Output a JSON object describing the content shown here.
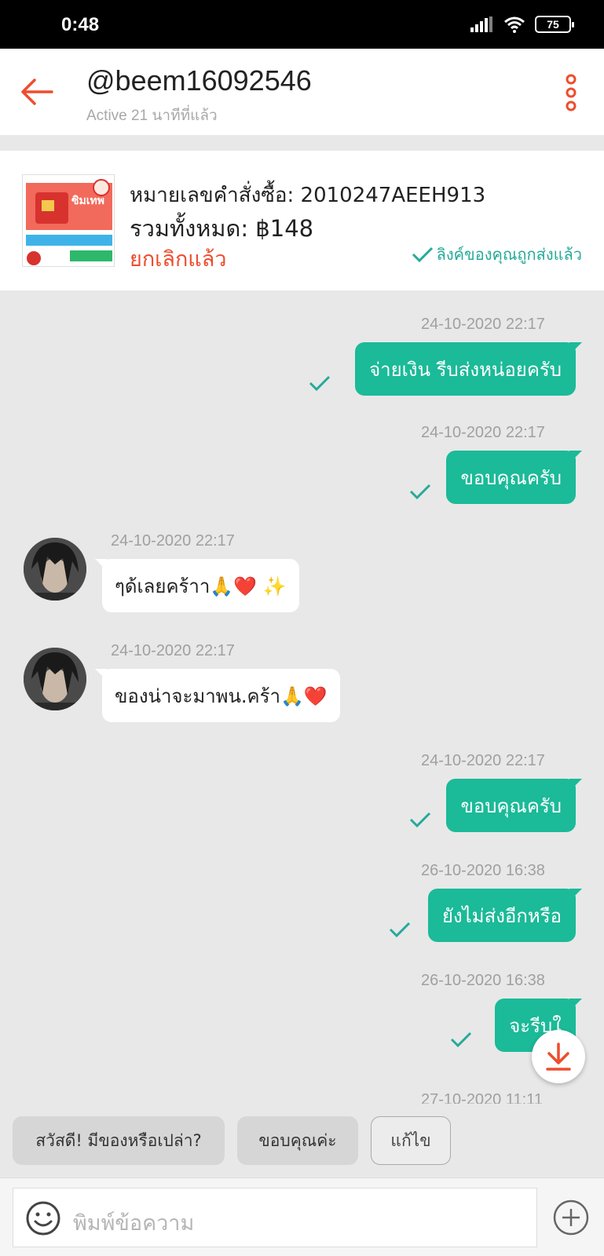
{
  "status_bar": {
    "time": "0:48",
    "battery": "75"
  },
  "header": {
    "title": "@beem16092546",
    "subtitle": "Active 21 นาทีที่แล้ว",
    "accent_color": "#ee4d2d"
  },
  "order": {
    "number_label": "หมายเลขคำสั่งซื้อ: 2010247AEEH913",
    "total_label": "รวมทั้งหมด: ฿148",
    "status": "ยกเลิกแล้ว",
    "link_status": "ลิงค์ของคุณถูกส่งแล้ว",
    "thumb_text": "ซิมเทพ"
  },
  "messages": [
    {
      "direction": "out",
      "time": "24-10-2020 22:17",
      "text": "จ่ายเงิน รีบส่งหน่อยครับ"
    },
    {
      "direction": "out",
      "time": "24-10-2020 22:17",
      "text": "ขอบคุณครับ"
    },
    {
      "direction": "in",
      "time": "24-10-2020 22:17",
      "text": "ๆด้เลยคร้าา🙏❤️ ✨"
    },
    {
      "direction": "in",
      "time": "24-10-2020 22:17",
      "text": "ของน่าจะมาพน.คร้า🙏❤️"
    },
    {
      "direction": "out",
      "time": "24-10-2020 22:17",
      "text": "ขอบคุณครับ"
    },
    {
      "direction": "out",
      "time": "26-10-2020 16:38",
      "text": "ยังไม่ส่งอีกหรือ"
    },
    {
      "direction": "out",
      "time": "26-10-2020 16:38",
      "text": "จะรีบใ"
    },
    {
      "direction": "out",
      "time": "27-10-2020 11:11",
      "text": ""
    }
  ],
  "quick_replies": [
    "สวัสดี! มีของหรือเปล่า?",
    "ขอบคุณค่ะ",
    "แก้ไข"
  ],
  "composer": {
    "placeholder": "พิมพ์ข้อความ"
  },
  "icons": [
    "back-arrow-icon",
    "more-vertical-icon",
    "check-icon",
    "scroll-down-icon",
    "emoji-icon",
    "plus-circle-icon",
    "signal-icon",
    "wifi-icon"
  ],
  "colors": {
    "outgoing_bubble": "#1bba98",
    "link_sent": "#26aa99",
    "cancelled": "#ee4d2d"
  }
}
